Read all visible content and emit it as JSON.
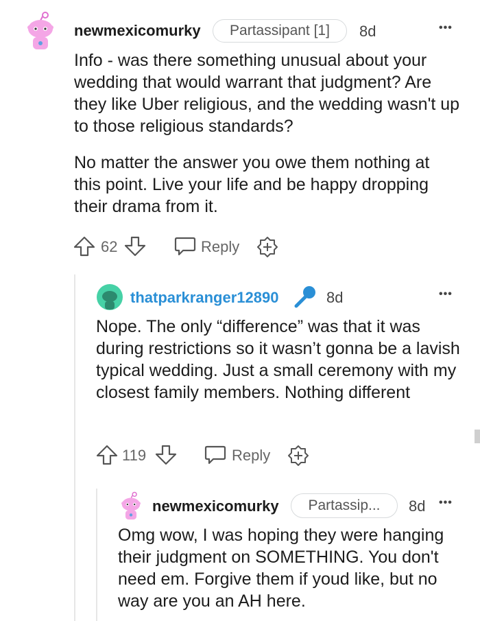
{
  "comments": [
    {
      "username": "newmexicomurky",
      "flair": "Partassipant [1]",
      "time": "8d",
      "more": "•••",
      "paragraphs": [
        "Info - was there something unusual about your wedding that would warrant that judgment? Are they like Uber religious, and the wedding wasn't up to those religious standards?",
        "No matter the answer you owe them nothing at this point. Live your life and be happy dropping their drama from it."
      ],
      "votes": "62",
      "reply_label": "Reply"
    },
    {
      "username": "thatparkranger12890",
      "time": "8d",
      "more": "•••",
      "paragraphs": [
        "Nope. The only “difference” was that it was during restrictions so it wasn’t gonna be a lavish typical wedding. Just a small ceremony with my closest family members. Nothing different"
      ],
      "votes": "119",
      "reply_label": "Reply"
    },
    {
      "username": "newmexicomurky",
      "flair": "Partassip...",
      "time": "8d",
      "more": "•••",
      "paragraphs": [
        "Omg wow, I was hoping they were hanging their judgment on SOMETHING. You don't need em. Forgive them if youd like, but no way are you an AH here."
      ]
    }
  ],
  "colors": {
    "op_username": "#1c1c1c",
    "reply_username": "#2a8fd6",
    "avatar_pink": "#f4a6e6",
    "avatar_teal": "#46d1a6",
    "mic_blue": "#2a8fd6"
  }
}
